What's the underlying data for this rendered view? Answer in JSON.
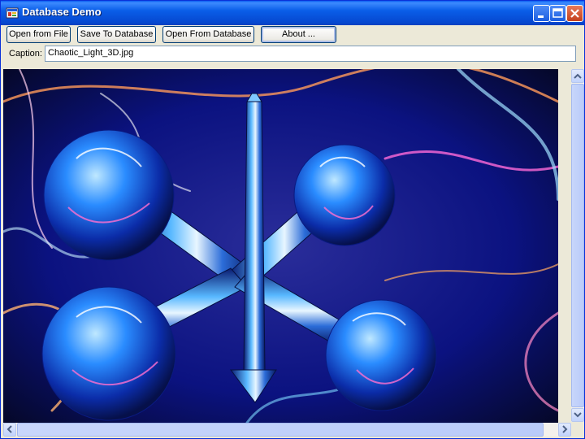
{
  "window": {
    "title": "Database Demo"
  },
  "toolbar": {
    "open_file": "Open from File",
    "save_db": "Save To Database",
    "open_db": "Open From Database",
    "about": "About ..."
  },
  "caption": {
    "label": "Caption:",
    "value": "Chaotic_Light_3D.jpg"
  },
  "image": {
    "name": "Chaotic_Light_3D.jpg"
  },
  "icons": {
    "app": "app-icon",
    "minimize": "minimize-icon",
    "maximize": "maximize-icon",
    "close": "close-icon",
    "scroll_up": "arrow-up-icon",
    "scroll_down": "arrow-down-icon",
    "scroll_left": "arrow-left-icon",
    "scroll_right": "arrow-right-icon"
  },
  "colors": {
    "titlebar": "#0a5ee8",
    "window_bg": "#ece9d8"
  }
}
